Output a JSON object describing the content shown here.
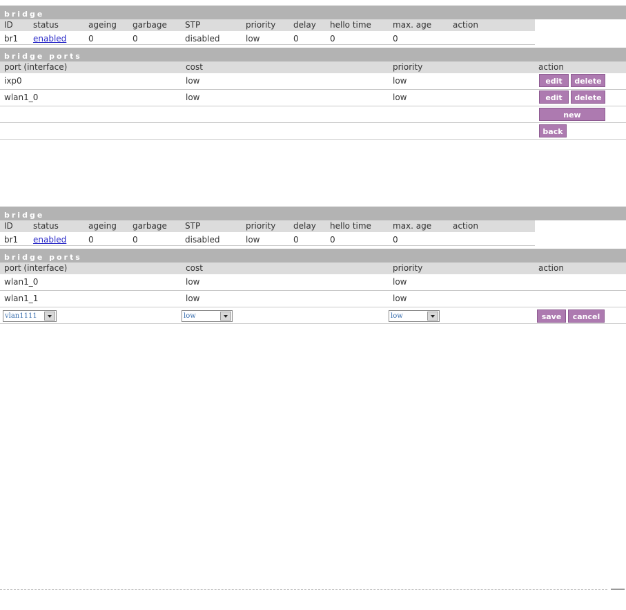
{
  "panel1": {
    "bridge_title": "bridge",
    "bridge_headers": [
      "ID",
      "status",
      "ageing",
      "garbage",
      "STP",
      "priority",
      "delay",
      "hello time",
      "max. age",
      "action"
    ],
    "bridge_row": {
      "id": "br1",
      "status": "enabled",
      "ageing": "0",
      "garbage": "0",
      "stp": "disabled",
      "priority": "low",
      "delay": "0",
      "hello": "0",
      "maxage": "0"
    },
    "ports_title": "bridge ports",
    "ports_headers": [
      "port (interface)",
      "cost",
      "priority",
      "action"
    ],
    "ports": [
      {
        "port": "ixp0",
        "cost": "low",
        "priority": "low"
      },
      {
        "port": "wlan1_0",
        "cost": "low",
        "priority": "low"
      }
    ],
    "edit_label": "edit",
    "delete_label": "delete",
    "new_label": "new",
    "back_label": "back"
  },
  "panel2": {
    "bridge_title": "bridge",
    "bridge_headers": [
      "ID",
      "status",
      "ageing",
      "garbage",
      "STP",
      "priority",
      "delay",
      "hello time",
      "max. age",
      "action"
    ],
    "bridge_row": {
      "id": "br1",
      "status": "enabled",
      "ageing": "0",
      "garbage": "0",
      "stp": "disabled",
      "priority": "low",
      "delay": "0",
      "hello": "0",
      "maxage": "0"
    },
    "ports_title": "bridge ports",
    "ports_headers": [
      "port (interface)",
      "cost",
      "priority",
      "action"
    ],
    "ports": [
      {
        "port": "wlan1_0",
        "cost": "low",
        "priority": "low"
      },
      {
        "port": "wlan1_1",
        "cost": "low",
        "priority": "low"
      }
    ],
    "new_port_select": "vlan1111",
    "new_cost_select": "low",
    "new_priority_select": "low",
    "save_label": "save",
    "cancel_label": "cancel"
  }
}
